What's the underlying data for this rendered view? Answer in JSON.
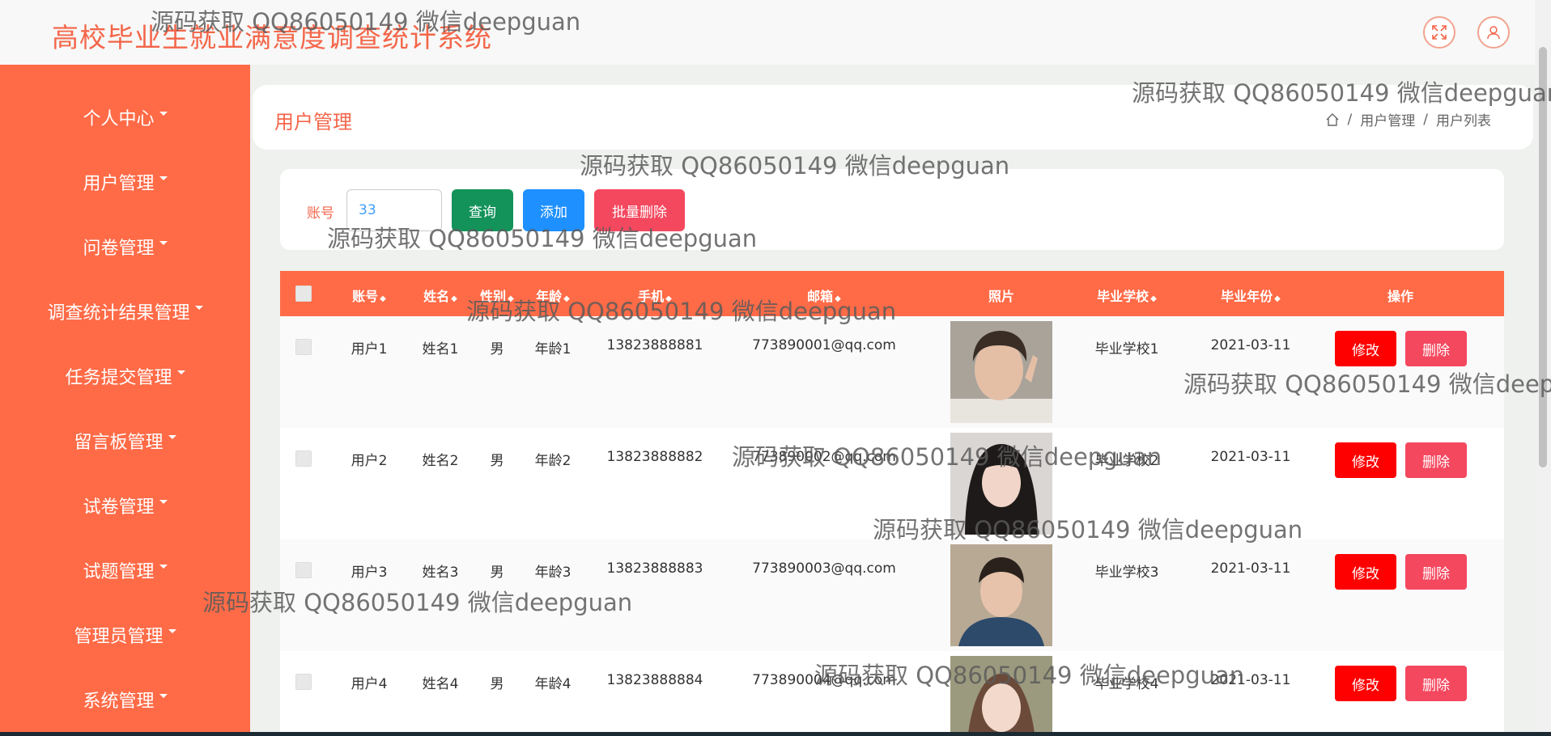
{
  "header": {
    "title": "高校毕业生就业满意度调查统计系统",
    "fullscreen_icon": "fullscreen-icon",
    "user_icon": "user-icon"
  },
  "sidebar": {
    "items": [
      {
        "label": "个人中心"
      },
      {
        "label": "用户管理"
      },
      {
        "label": "问卷管理"
      },
      {
        "label": "调查统计结果管理"
      },
      {
        "label": "任务提交管理"
      },
      {
        "label": "留言板管理"
      },
      {
        "label": "试卷管理"
      },
      {
        "label": "试题管理"
      },
      {
        "label": "管理员管理"
      },
      {
        "label": "系统管理"
      }
    ]
  },
  "page": {
    "title": "用户管理",
    "breadcrumb": [
      "用户管理",
      "用户列表"
    ]
  },
  "search": {
    "label": "账号",
    "value": "33",
    "query_label": "查询",
    "add_label": "添加",
    "batch_delete_label": "批量删除"
  },
  "table": {
    "columns": [
      "账号",
      "姓名",
      "性别",
      "年龄",
      "手机",
      "邮箱",
      "照片",
      "毕业学校",
      "毕业年份",
      "操作"
    ],
    "rows": [
      {
        "account": "用户1",
        "name": "姓名1",
        "gender": "男",
        "age": "年龄1",
        "phone": "13823888881",
        "email": "773890001@qq.com",
        "school": "毕业学校1",
        "year": "2021-03-11"
      },
      {
        "account": "用户2",
        "name": "姓名2",
        "gender": "男",
        "age": "年龄2",
        "phone": "13823888882",
        "email": "773890002@qq.com",
        "school": "毕业学校2",
        "year": "2021-03-11"
      },
      {
        "account": "用户3",
        "name": "姓名3",
        "gender": "男",
        "age": "年龄3",
        "phone": "13823888883",
        "email": "773890003@qq.com",
        "school": "毕业学校3",
        "year": "2021-03-11"
      },
      {
        "account": "用户4",
        "name": "姓名4",
        "gender": "男",
        "age": "年龄4",
        "phone": "13823888884",
        "email": "773890004@qq.com",
        "school": "毕业学校4",
        "year": "2021-03-11"
      }
    ],
    "edit_label": "修改",
    "delete_label": "删除"
  },
  "watermark": "源码获取 QQ86050149 微信deepguan",
  "colors": {
    "accent": "#ff6b47",
    "query_button": "#13935a",
    "add_button": "#1e90ff",
    "batch_delete_button": "#f4485f",
    "edit_button": "#ff0000",
    "delete_button": "#f4485f"
  }
}
